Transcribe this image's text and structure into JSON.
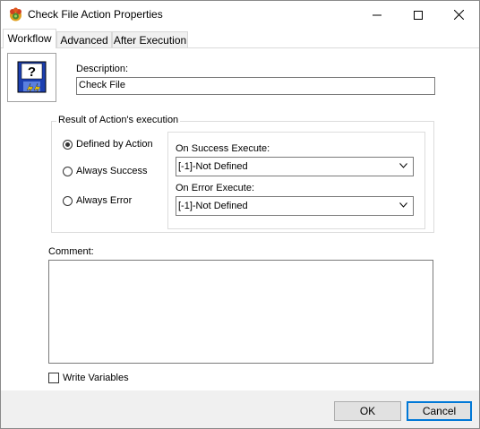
{
  "window": {
    "title": "Check File Action Properties",
    "icons": {
      "app": "gear-flower-icon",
      "minimize": "minimize-icon",
      "maximize": "maximize-icon",
      "close": "close-icon"
    }
  },
  "tabs": [
    {
      "label": "Workflow",
      "active": true
    },
    {
      "label": "Advanced",
      "active": false
    },
    {
      "label": "After Execution",
      "active": false
    }
  ],
  "workflow": {
    "action_icon": "floppy-question-icon",
    "description_label": "Description:",
    "description_value": "Check File",
    "result_group": {
      "title": "Result of Action's execution",
      "options": [
        {
          "label": "Defined by  Action",
          "checked": true
        },
        {
          "label": "Always Success",
          "checked": false
        },
        {
          "label": "Always Error",
          "checked": false
        }
      ],
      "on_success_label": "On Success Execute:",
      "on_success_value": "[-1]-Not Defined",
      "on_error_label": "On Error Execute:",
      "on_error_value": "[-1]-Not Defined"
    },
    "comment_label": "Comment:",
    "comment_value": "",
    "write_variables_label": "Write Variables",
    "write_variables_checked": false
  },
  "buttons": {
    "ok": "OK",
    "cancel": "Cancel"
  },
  "colors": {
    "accent": "#0078d7",
    "footer_bg": "#f0f0f0"
  }
}
